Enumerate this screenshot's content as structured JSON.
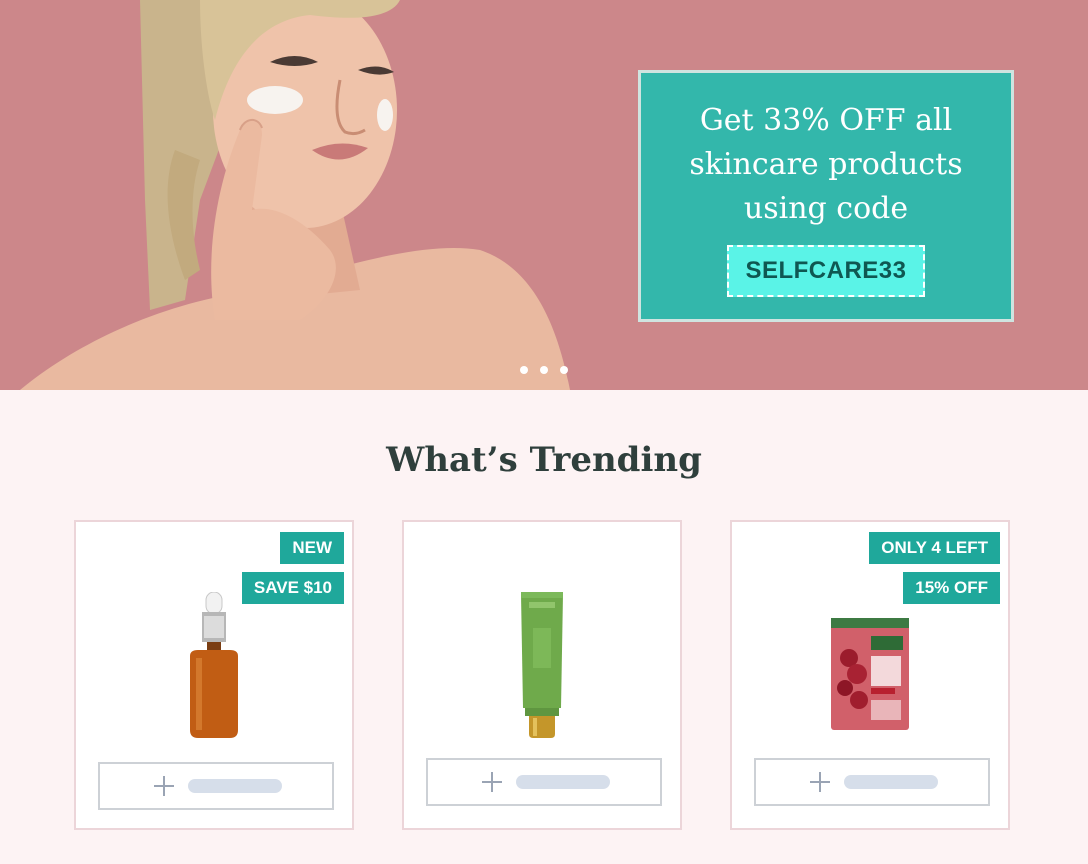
{
  "hero": {
    "promo_line1": "Get 33% OFF all",
    "promo_line2": "skincare products",
    "promo_line3": "using code",
    "promo_code": "SELFCARE33",
    "slide_count": 3,
    "colors": {
      "background": "#cc878a",
      "promo_bg": "#33b7ab",
      "code_bg": "#5af3e7"
    }
  },
  "trending": {
    "title": "What’s Trending",
    "products": [
      {
        "badges": [
          "NEW",
          "SAVE $10"
        ],
        "image": "serum-dropper-bottle",
        "add_icon": "plus-icon"
      },
      {
        "badges": [],
        "image": "green-cream-tube",
        "add_icon": "plus-icon"
      },
      {
        "badges": [
          "ONLY 4 LEFT",
          "15% OFF"
        ],
        "image": "sheet-mask-pack",
        "add_icon": "plus-icon"
      }
    ],
    "colors": {
      "badge": "#1fa89b",
      "card_border": "#ecd5d9"
    }
  }
}
